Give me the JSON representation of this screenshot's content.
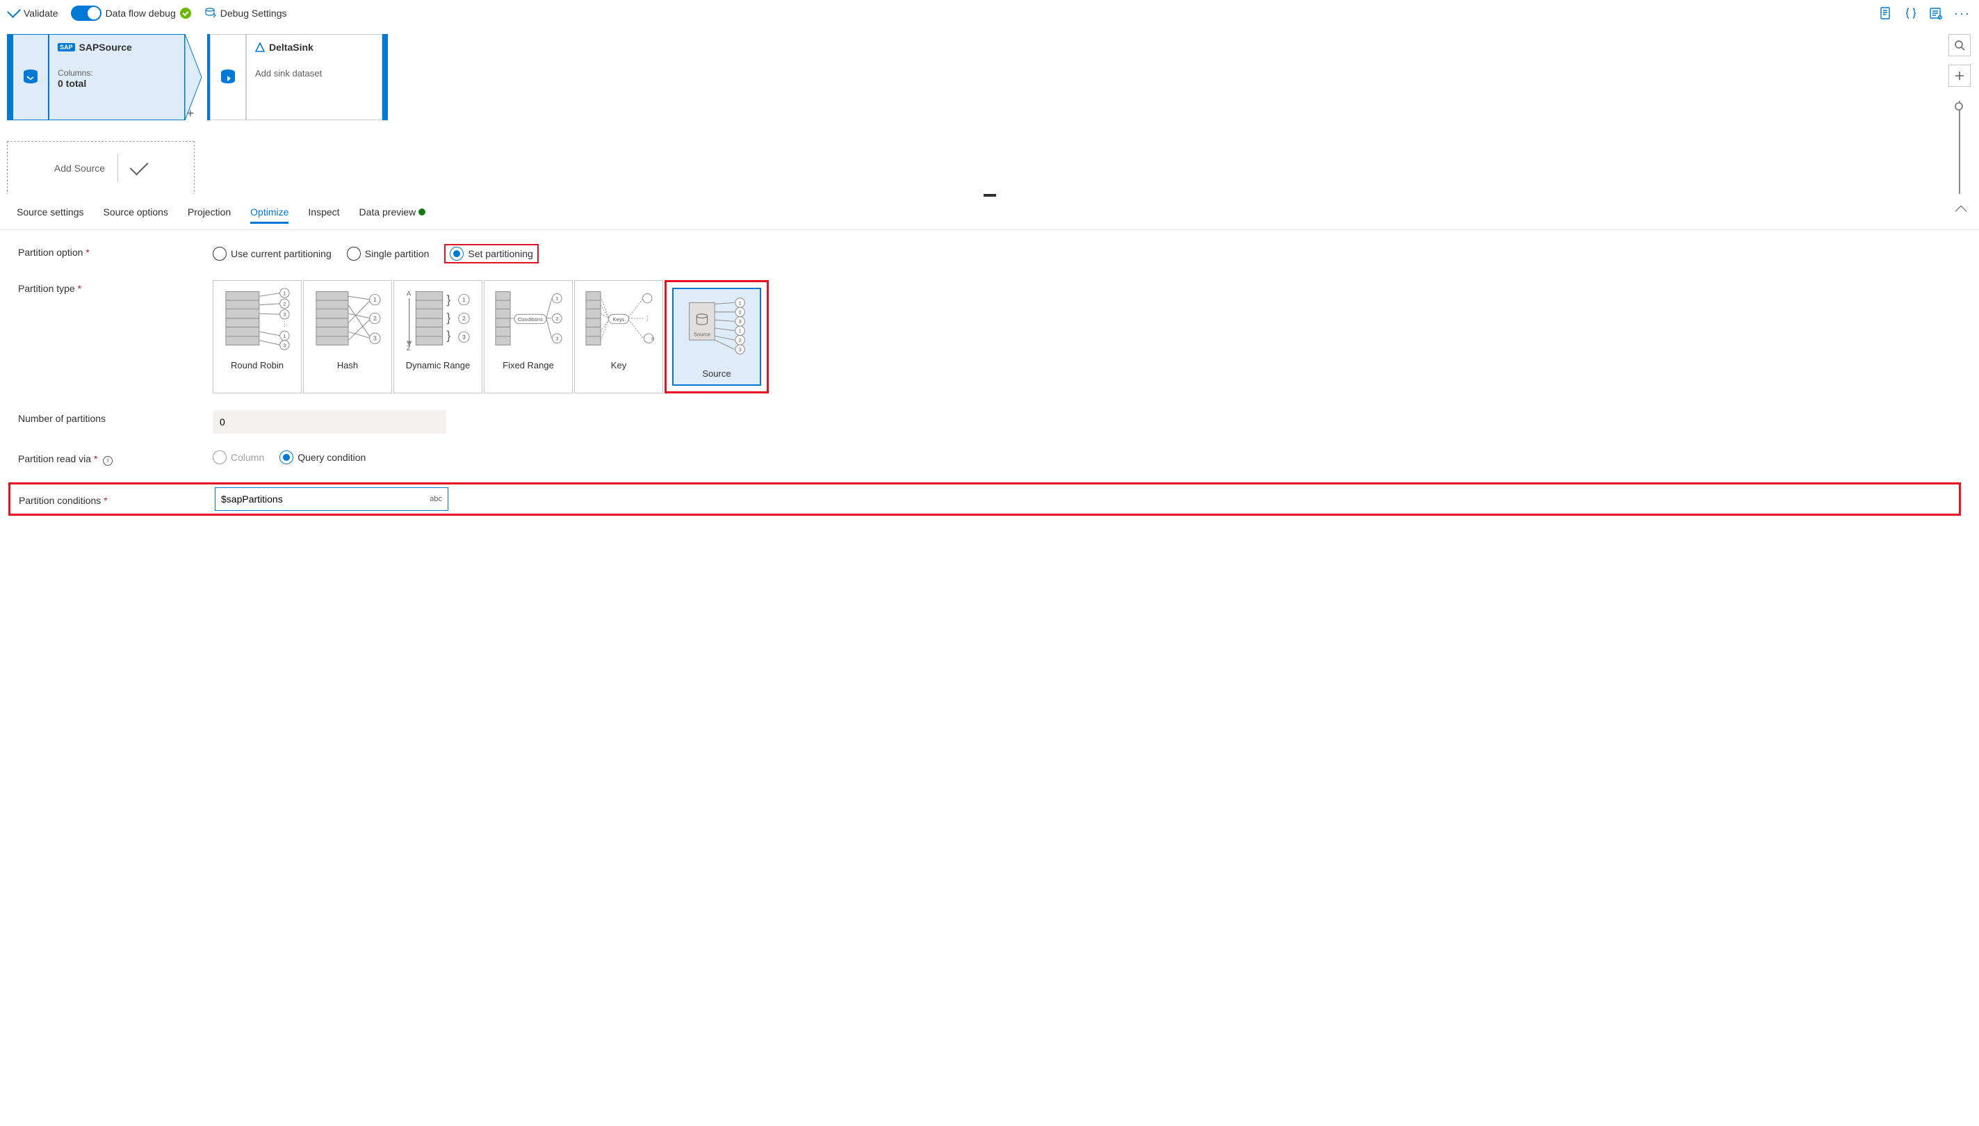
{
  "toolbar": {
    "validate": "Validate",
    "debug_toggle_label": "Data flow debug",
    "debug_settings": "Debug Settings"
  },
  "canvas": {
    "source": {
      "title": "SAPSource",
      "columns_label": "Columns:",
      "columns_count": "0 total"
    },
    "sink": {
      "title": "DeltaSink",
      "subtitle": "Add sink dataset"
    },
    "add_source": "Add Source"
  },
  "tabs": {
    "items": [
      "Source settings",
      "Source options",
      "Projection",
      "Optimize",
      "Inspect",
      "Data preview"
    ],
    "active": "Optimize"
  },
  "form": {
    "partition_option_label": "Partition option",
    "partition_options": [
      "Use current partitioning",
      "Single partition",
      "Set partitioning"
    ],
    "partition_type_label": "Partition type",
    "partition_types": [
      "Round Robin",
      "Hash",
      "Dynamic Range",
      "Fixed Range",
      "Key",
      "Source"
    ],
    "num_partitions_label": "Number of partitions",
    "num_partitions_value": "0",
    "read_via_label": "Partition read via",
    "read_via_options": [
      "Column",
      "Query condition"
    ],
    "conditions_label": "Partition conditions",
    "conditions_value": "$sapPartitions",
    "abc": "abc"
  }
}
